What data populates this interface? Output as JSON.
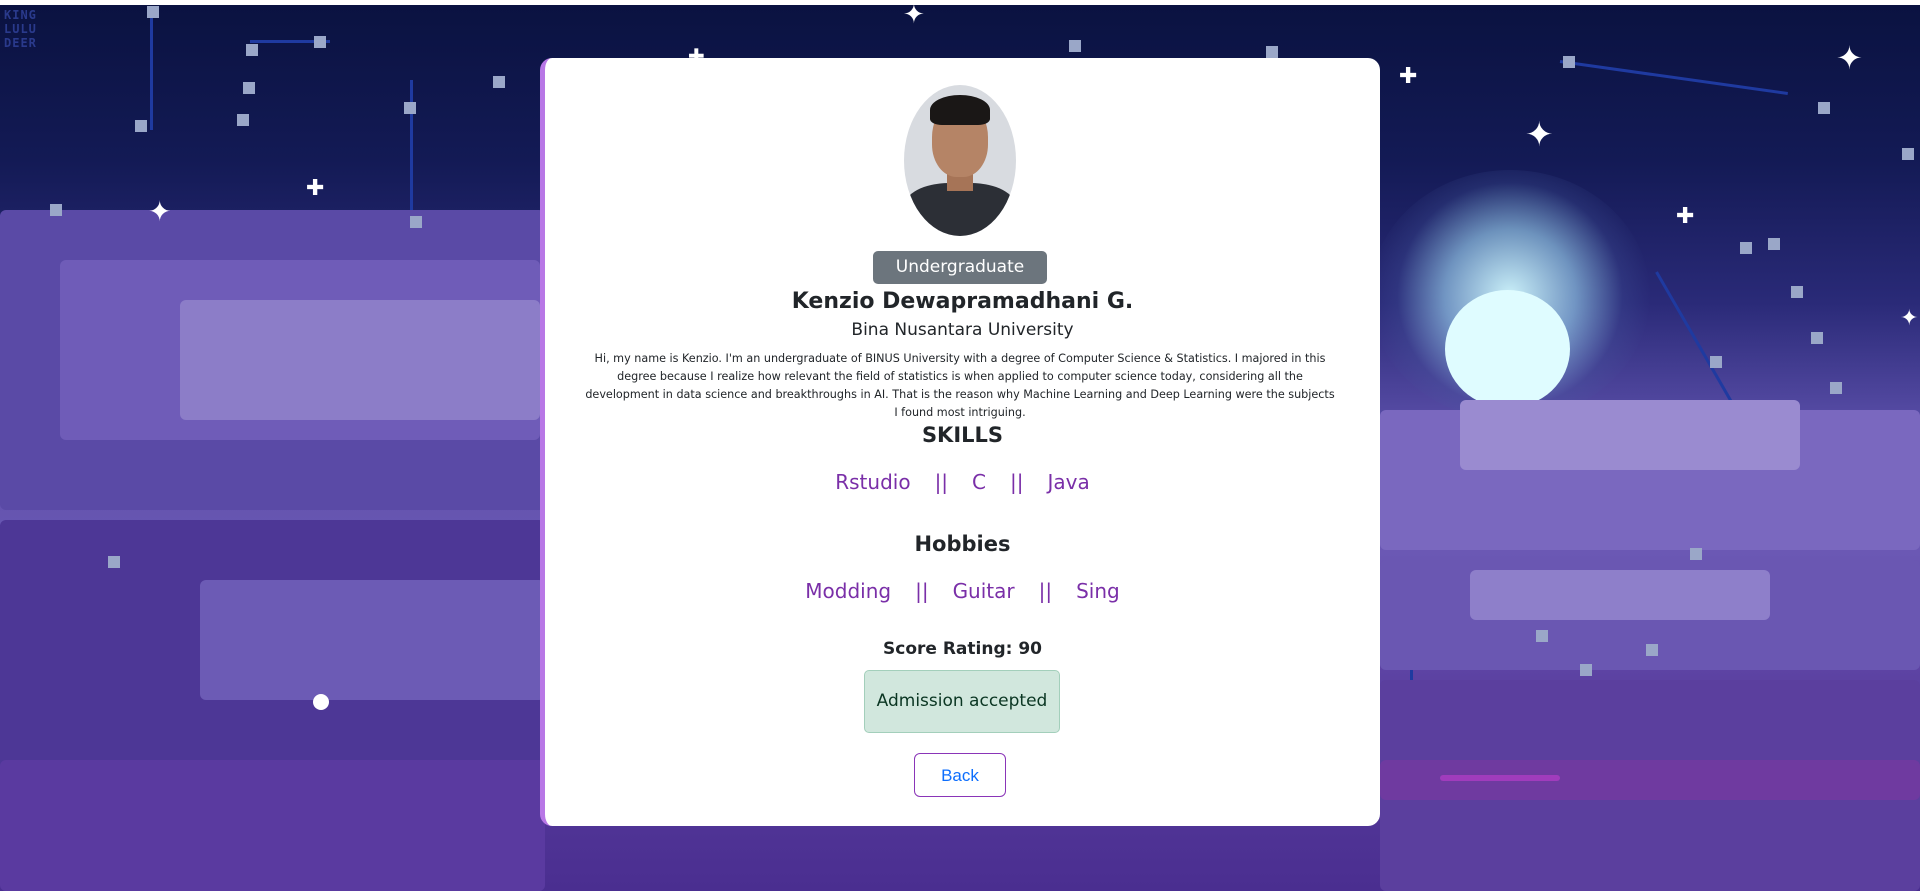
{
  "background": {
    "logo_text": "KING LULU DEER",
    "colors": {
      "sky_top": "#0a1240",
      "sky_mid": "#2a2a78",
      "cloud": "#6b58b4",
      "moon": "#dffcff"
    }
  },
  "profile": {
    "badge": "Undergraduate",
    "name": "Kenzio Dewapramadhani G.",
    "university": "Bina Nusantara University",
    "bio": "Hi, my name is Kenzio. I'm an undergraduate of BINUS University with a degree of Computer Science & Statistics. I majored in this degree because I realize how relevant the field of statistics is when applied to computer science today, considering all the development in data science and breakthroughs in AI. That is the reason why Machine Learning and Deep Learning were the subjects I found most intriguing."
  },
  "skills": {
    "title": "SKILLS",
    "items": [
      "Rstudio",
      "C",
      "Java"
    ],
    "separator": "||"
  },
  "hobbies": {
    "title": "Hobbies",
    "items": [
      "Modding",
      "Guitar",
      "Sing"
    ],
    "separator": "||"
  },
  "score": {
    "text": "Score Rating: 90"
  },
  "status": {
    "text": "Admission accepted",
    "color": "#d1e7dd"
  },
  "actions": {
    "back_label": "Back"
  },
  "accent_color": "#7a2fa8"
}
